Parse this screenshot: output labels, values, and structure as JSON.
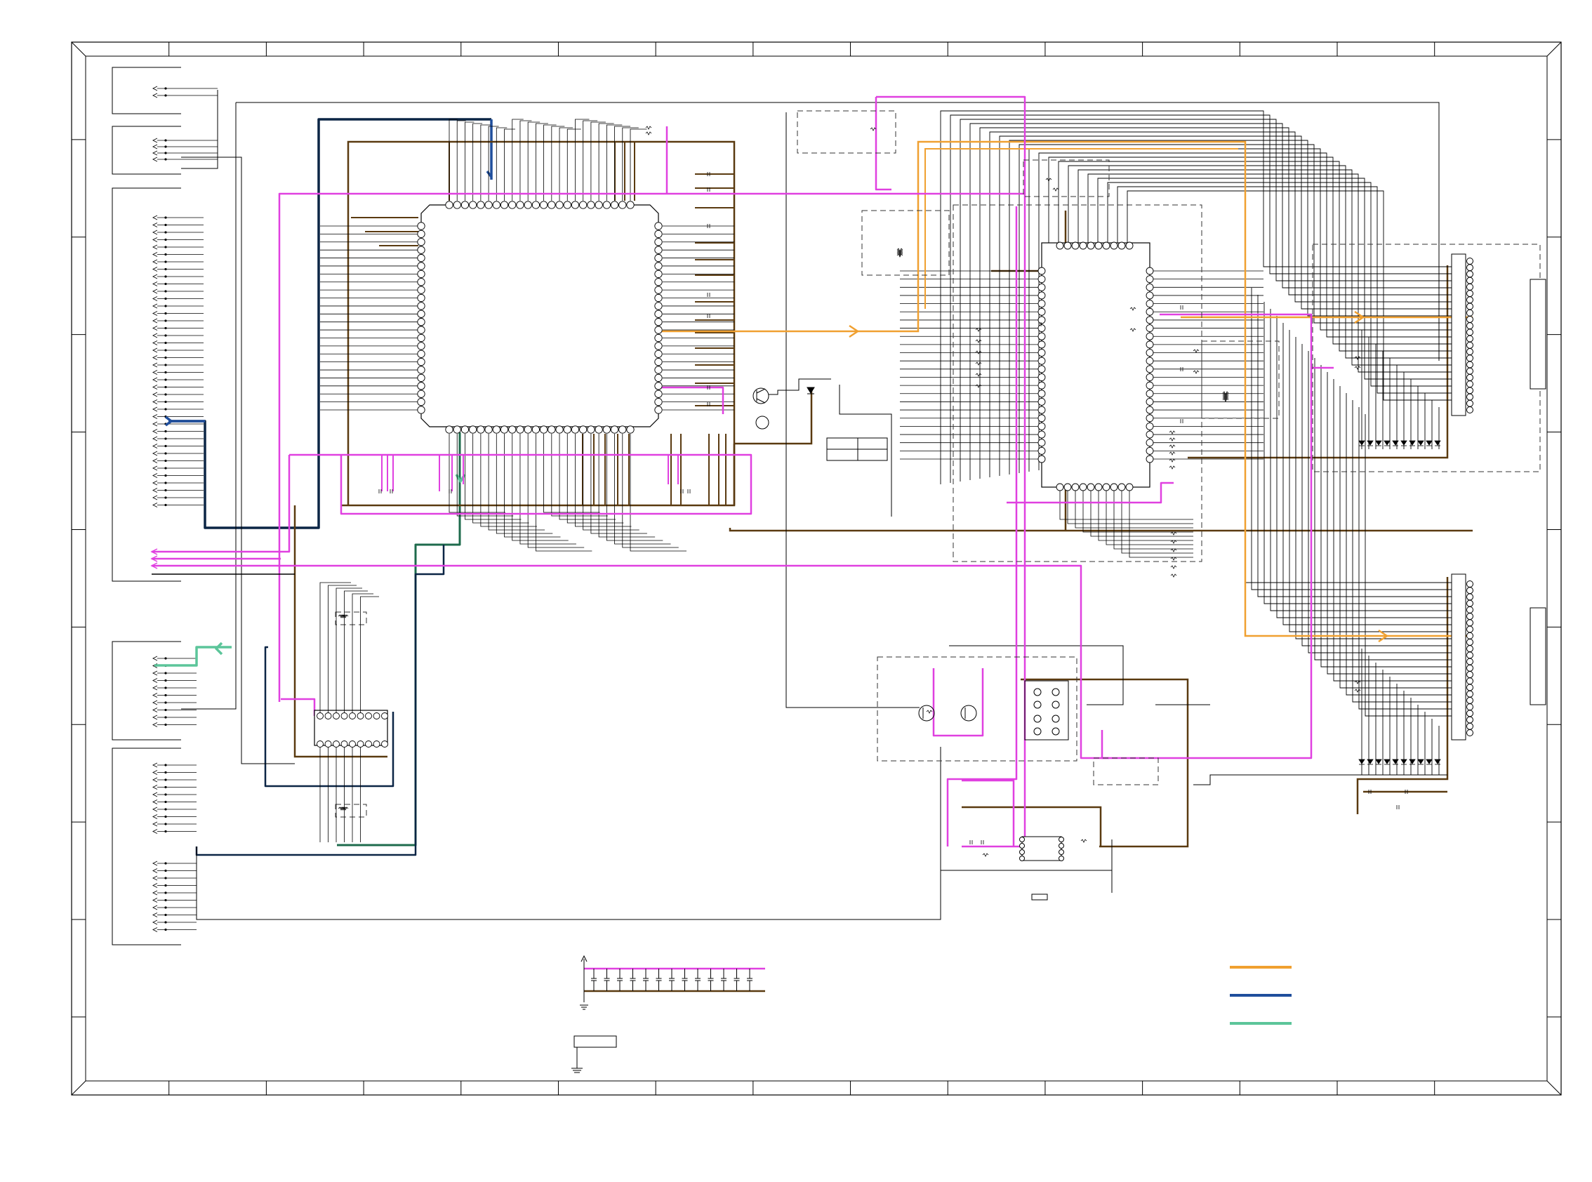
{
  "colors": {
    "background": "#ffffff",
    "frame": "#000000",
    "signal_wire": "#000000",
    "power_wire": "#5a3a10",
    "control_wire": "#e040e0",
    "highlight_orange": "#f0a030",
    "highlight_blue": "#1f4e9c",
    "highlight_green": "#5cc59a",
    "highlight_navy": "#0b2545",
    "dashed_block": "#333333"
  },
  "legend": [
    {
      "color": "#f0a030",
      "label": ""
    },
    {
      "color": "#1f4e9c",
      "label": ""
    },
    {
      "color": "#5cc59a",
      "label": ""
    }
  ],
  "components": {
    "main_cpu": {
      "pins_per_side": 24,
      "icon": "qfp-ic"
    },
    "sub_ic": {
      "pins_per_side": 24,
      "icon": "qfp-ic"
    },
    "driver_ic": {
      "pins_per_side": 9,
      "icon": "dip-ic"
    },
    "eeprom": {
      "pins_per_side": 4,
      "icon": "soic-ic"
    },
    "connector_upper": {
      "pins": 24,
      "icon": "pin-header"
    },
    "connector_lower": {
      "pins": 24,
      "icon": "pin-header"
    },
    "led_row_upper": {
      "count": 10,
      "icon": "diode"
    },
    "led_row_lower": {
      "count": 10,
      "icon": "diode"
    },
    "decoupling_caps": {
      "count": 13,
      "icon": "capacitor"
    }
  }
}
